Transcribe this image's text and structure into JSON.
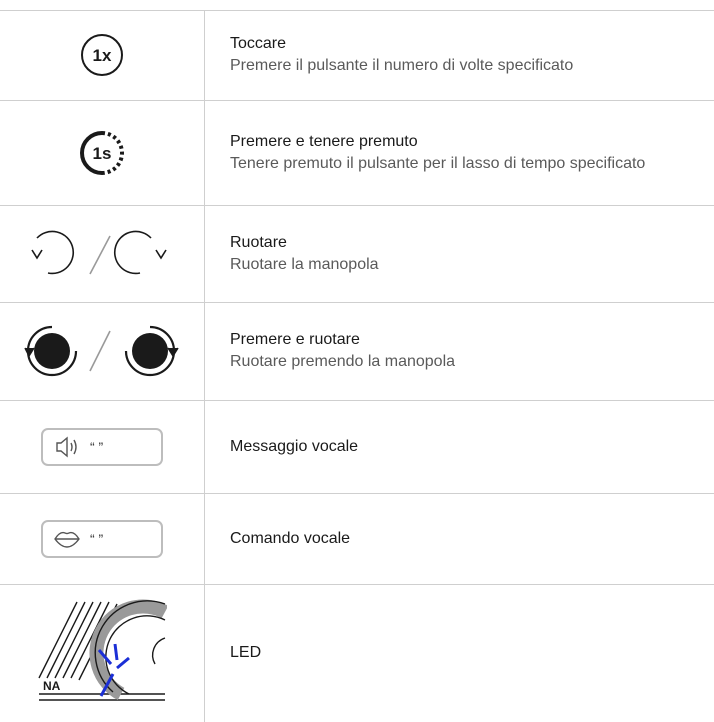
{
  "rows": [
    {
      "icon": "tap-once-icon",
      "icon_text": "1x",
      "title": "Toccare",
      "desc": "Premere il pulsante il numero di volte specificato"
    },
    {
      "icon": "press-and-hold-icon",
      "icon_text": "1s",
      "title": "Premere e tenere premuto",
      "desc": "Tenere premuto il pulsante per il lasso di tempo specificato"
    },
    {
      "icon": "rotate-icon",
      "title": "Ruotare",
      "desc": "Ruotare la manopola"
    },
    {
      "icon": "press-and-rotate-icon",
      "title": "Premere e ruotare",
      "desc": "Ruotare premendo la manopola"
    },
    {
      "icon": "voice-message-icon",
      "title": "Messaggio vocale"
    },
    {
      "icon": "voice-command-icon",
      "title": "Comando vocale"
    },
    {
      "icon": "led-icon",
      "icon_text": "NA",
      "title": "LED"
    }
  ],
  "colors": {
    "divider": "#cfcfcf",
    "icon_dark": "#1a1a1a",
    "led_blue": "#1b2fd6",
    "knob_grey": "#9a9a9a"
  },
  "quote_glyphs": "“ ”"
}
